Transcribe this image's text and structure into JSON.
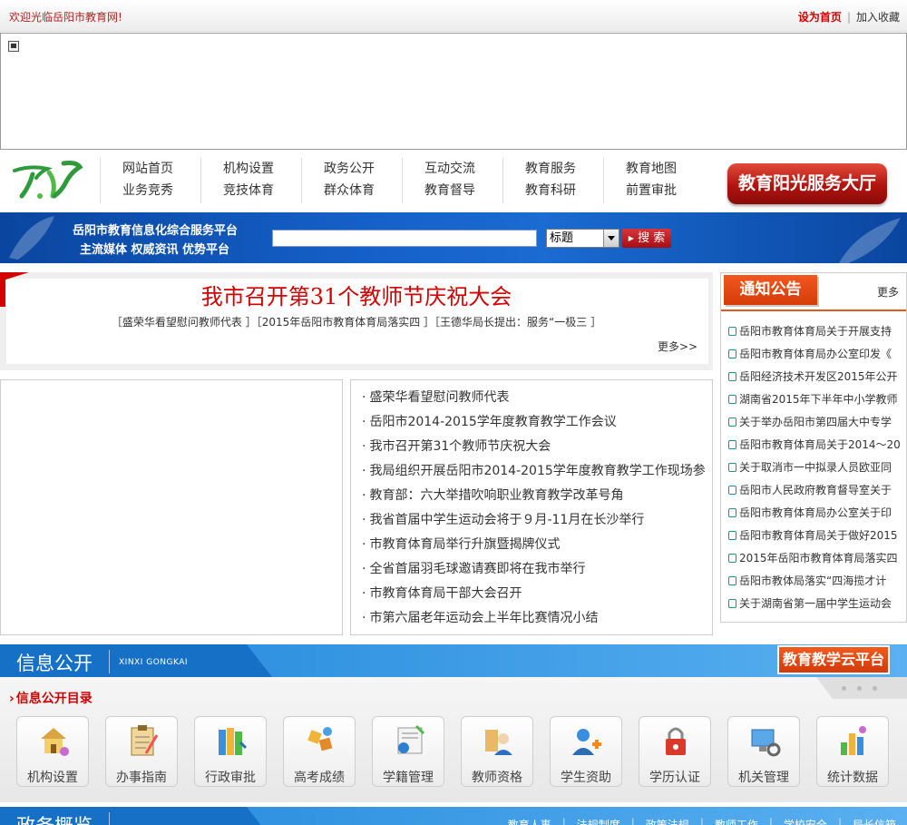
{
  "topbar": {
    "welcome": "欢迎光临岳阳市教育网!",
    "set_home": "设为首页",
    "separator": "|",
    "add_favorite": "加入收藏"
  },
  "nav": {
    "columns": [
      [
        "网站首页",
        "业务竞秀"
      ],
      [
        "机构设置",
        "竞技体育"
      ],
      [
        "政务公开",
        "群众体育"
      ],
      [
        "互动交流",
        "教育督导"
      ],
      [
        "教育服务",
        "教育科研"
      ],
      [
        "教育地图",
        "前置审批"
      ]
    ],
    "hall_button": "教育阳光服务大厅"
  },
  "search": {
    "slogan_line1": "岳阳市教育信息化综合服务平台",
    "slogan_line2": "主流媒体 权威资讯 优势平台",
    "query": "",
    "field_selected": "标题",
    "button": "搜 索"
  },
  "headline": {
    "title": "我市召开第31个教师节庆祝大会",
    "sub_links": "［盛荣华看望慰问教师代表 ］［2015年岳阳市教育体育局落实四 ］［王德华局长提出：服务“一极三 ］",
    "more": "更多>>"
  },
  "news": [
    "盛荣华看望慰问教师代表",
    "岳阳市2014-2015学年度教育教学工作会议",
    "我市召开第31个教师节庆祝大会",
    "我局组织开展岳阳市2014-2015学年度教育教学工作现场参",
    "教育部：六大举措吹响职业教育教学改革号角",
    "我省首届中学生运动会将于９月-11月在长沙举行",
    "市教育体育局举行升旗暨揭牌仪式",
    "全省首届羽毛球邀请赛即将在我市举行",
    "市教育体育局干部大会召开",
    "市第六届老年运动会上半年比赛情况小结"
  ],
  "notices": {
    "title": "通知公告",
    "more": "更多",
    "items": [
      "岳阳市教育体育局关于开展支持",
      "岳阳市教育体育局办公室印发《",
      "岳阳经济技术开发区2015年公开",
      "湖南省2015年下半年中小学教师",
      "关于举办岳阳市第四届大中专学",
      "岳阳市教育体育局关于2014～20",
      "关于取消市一中拟录人员欧亚同",
      "岳阳市人民政府教育督导室关于",
      "岳阳市教育体育局办公室关于印",
      "岳阳市教育体育局关于做好2015",
      "2015年岳阳市教育体育局落实四",
      "岳阳市教体局落实“四海揽才计",
      "关于湖南省第一届中学生运动会"
    ]
  },
  "info_section": {
    "title": "信息公开",
    "pinyin": "XINXI GONGKAI",
    "cloud_button": "教育教学云平台",
    "catalog_title": "信息公开目录",
    "tiles": [
      "机构设置",
      "办事指南",
      "行政审批",
      "高考成绩",
      "学籍管理",
      "教师资格",
      "学生资助",
      "学历认证",
      "机关管理",
      "统计数据"
    ]
  },
  "affairs_section": {
    "title": "政务概览",
    "links": [
      "教育人事",
      "法规制度",
      "政策法规",
      "教师工作",
      "学校安全",
      "局长信箱"
    ]
  },
  "colors": {
    "brand_red": "#d40000",
    "nav_blue": "#1560c8",
    "notice_orange": "#e35b1c"
  }
}
